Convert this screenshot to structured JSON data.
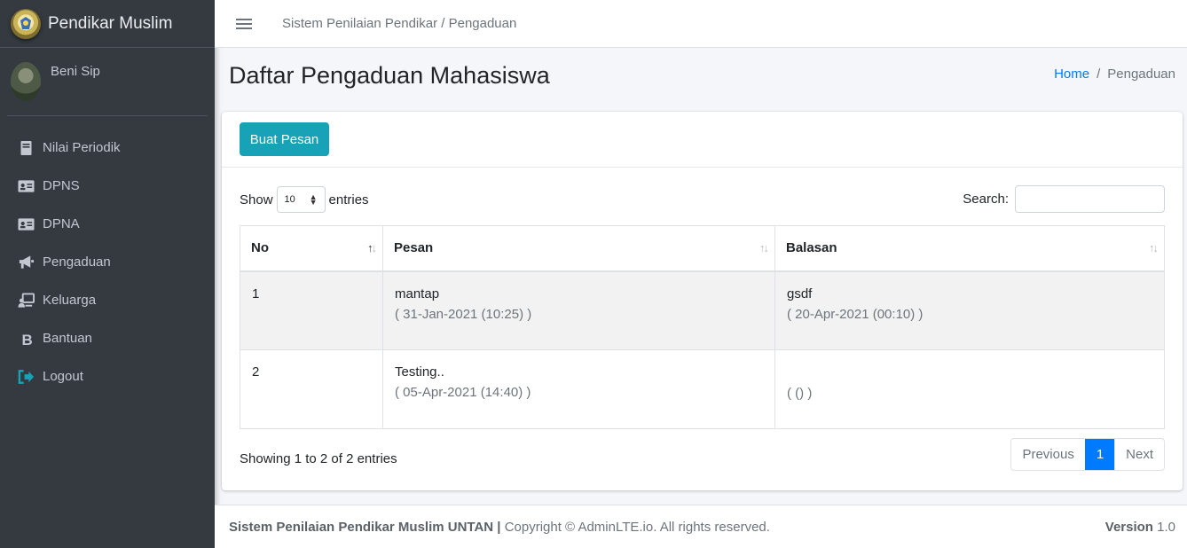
{
  "brand": {
    "name": "Pendikar Muslim"
  },
  "user": {
    "name": "Beni Sip"
  },
  "sidebar": {
    "items": [
      {
        "label": "Nilai Periodik",
        "icon": "book-icon"
      },
      {
        "label": "DPNS",
        "icon": "id-card-icon"
      },
      {
        "label": "DPNA",
        "icon": "id-card-icon"
      },
      {
        "label": "Pengaduan",
        "icon": "bullhorn-icon"
      },
      {
        "label": "Keluarga",
        "icon": "chalkboard-user-icon"
      },
      {
        "label": "Bantuan",
        "icon": "bold-b-icon"
      },
      {
        "label": "Logout",
        "icon": "sign-out-icon",
        "color": "#17a2b8"
      }
    ]
  },
  "topbar": {
    "crumb": "Sistem Penilaian Pendikar / Pengaduan"
  },
  "header": {
    "title": "Daftar Pengaduan Mahasiswa",
    "breadcrumb_home": "Home",
    "breadcrumb_sep": "/",
    "breadcrumb_current": "Pengaduan"
  },
  "card": {
    "create_button": "Buat Pesan",
    "show_label": "Show",
    "entries_value": "10",
    "entries_label": "entries",
    "search_label": "Search:",
    "search_value": ""
  },
  "table": {
    "headers": [
      "No",
      "Pesan",
      "Balasan"
    ],
    "rows": [
      {
        "no": "1",
        "pesan": "mantap",
        "pesan_date": "( 31-Jan-2021 (10:25) )",
        "balasan": "gsdf",
        "balasan_date": "( 20-Apr-2021 (00:10) )"
      },
      {
        "no": "2",
        "pesan": "Testing..",
        "pesan_date": "( 05-Apr-2021 (14:40) )",
        "balasan": "",
        "balasan_date": "( () )"
      }
    ],
    "info": "Showing 1 to 2 of 2 entries"
  },
  "pagination": {
    "previous": "Previous",
    "page": "1",
    "next": "Next"
  },
  "footer": {
    "org": "Sistem Penilaian Pendikar Muslim UNTAN",
    "sep": " | ",
    "copyright": "Copyright © AdminLTE.io. All rights reserved.",
    "version_label": "Version",
    "version": "1.0"
  },
  "colors": {
    "sidebar_bg": "#343a40",
    "accent": "#17a2b8",
    "link": "#007bff"
  }
}
